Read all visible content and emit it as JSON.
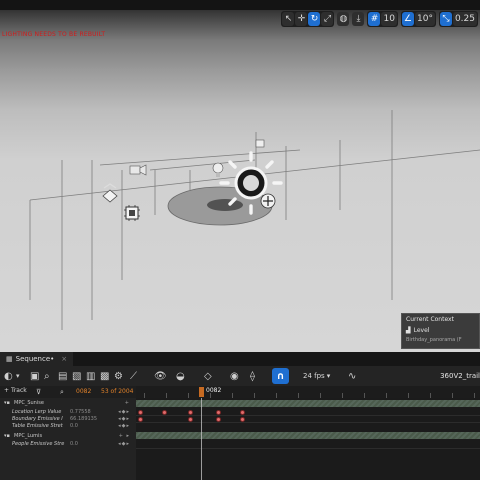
{
  "viewport": {
    "warning_text": "LIGHTING NEEDS TO BE REBUILT",
    "toolbar": {
      "camera_speed": "0.25",
      "grid_value": "10",
      "rotation_value": "10°",
      "scale_value": "0.25"
    },
    "context_panel": {
      "title": "Current Context",
      "level_label": "Level",
      "level_file": "Birthday_panorama (F"
    }
  },
  "sequencer": {
    "tab_label": "Sequence•",
    "track_button": "Track",
    "current_frame": "0082",
    "frame_counter": "53 of 2004",
    "fps": "24 fps",
    "sequence_name": "360V2_trail",
    "playhead_label": "0082",
    "outliner": [
      {
        "name": "MPC_Sunise",
        "value": "",
        "kind": "folder"
      },
      {
        "name": "Location Lerp Value",
        "value": "0.77558",
        "kind": "param"
      },
      {
        "name": "Boundary Emissive I",
        "value": "66.189135",
        "kind": "param"
      },
      {
        "name": "Table Emissive Stret",
        "value": "0.0",
        "kind": "param"
      },
      {
        "name": "MPC_Lumis",
        "value": "",
        "kind": "folder"
      },
      {
        "name": "People Emissive Stre",
        "value": "0.0",
        "kind": "param"
      }
    ]
  },
  "colors": {
    "accent": "#1f6fd1",
    "playhead": "#c66a22",
    "warning": "#d21a1a",
    "keyframe": "#e06c6c"
  }
}
